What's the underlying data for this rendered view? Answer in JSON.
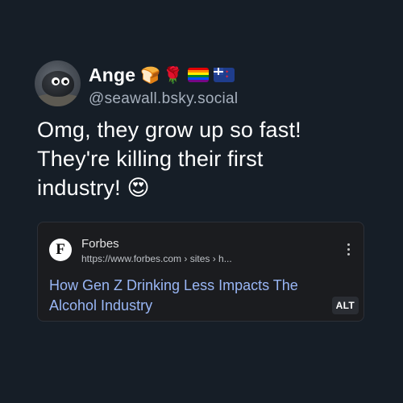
{
  "post": {
    "author": {
      "display_name": "Ange",
      "flair_emoji": [
        "🍞",
        "🌹"
      ],
      "handle": "@seawall.bsky.social"
    },
    "text_lines": [
      "Omg, they grow up so fast!",
      "They're killing their first",
      "industry! 😍"
    ],
    "link_card": {
      "favicon_letter": "F",
      "source_name": "Forbes",
      "url": "https://www.forbes.com › sites › h...",
      "headline": "How Gen Z Drinking Less Impacts The Alcohol Industry",
      "alt_label": "ALT"
    }
  },
  "colors": {
    "background": "#161e27",
    "link": "#99b6f5",
    "handle": "#a6b0bd",
    "card_bg": "#1b1c1f"
  }
}
